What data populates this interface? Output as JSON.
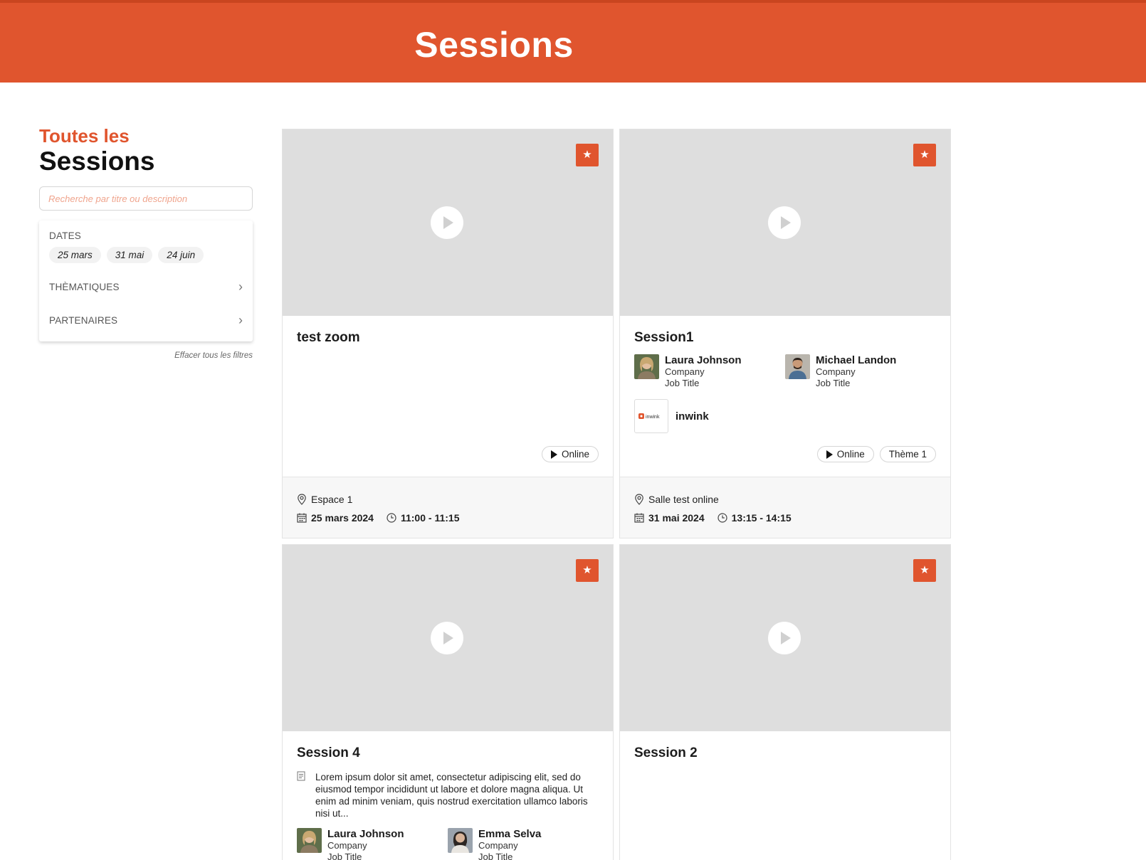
{
  "header": {
    "title": "Sessions"
  },
  "sidebar": {
    "kicker": "Toutes les",
    "title": "Sessions",
    "search_placeholder": "Recherche par titre ou description",
    "dates_label": "DATES",
    "date_chips": [
      "25 mars",
      "31 mai",
      "24 juin"
    ],
    "thematiques_label": "THÈMATIQUES",
    "partenaires_label": "PARTENAIRES",
    "clear_label": "Effacer tous les filtres"
  },
  "icons": {
    "favorite": "star-icon",
    "play": "play-icon",
    "location": "location-pin-icon",
    "calendar": "calendar-icon",
    "clock": "clock-icon",
    "description": "document-icon",
    "chevron": "chevron-right-icon"
  },
  "colors": {
    "brand": "#e0552e",
    "media_placeholder": "#dedede"
  },
  "cards": [
    {
      "title": "test zoom",
      "badges": [
        "Online"
      ],
      "location": "Espace 1",
      "date": "25 mars 2024",
      "time": "11:00 - 11:15"
    },
    {
      "title": "Session1",
      "speakers": [
        {
          "name": "Laura Johnson",
          "company": "Company",
          "job": "Job Title"
        },
        {
          "name": "Michael Landon",
          "company": "Company",
          "job": "Job Title"
        }
      ],
      "partner": {
        "name": "inwink",
        "logo_text": "inwink"
      },
      "badges": [
        "Online",
        "Thème 1"
      ],
      "location": "Salle test online",
      "date": "31 mai 2024",
      "time": "13:15 - 14:15"
    },
    {
      "title": "Session 4",
      "description": "Lorem ipsum dolor sit amet, consectetur adipiscing elit, sed do eiusmod tempor incididunt ut labore et dolore magna aliqua. Ut enim ad minim veniam, quis nostrud exercitation ullamco laboris nisi ut...",
      "speakers": [
        {
          "name": "Laura Johnson",
          "company": "Company",
          "job": "Job Title"
        },
        {
          "name": "Emma Selva",
          "company": "Company",
          "job": "Job Title"
        }
      ]
    },
    {
      "title": "Session 2"
    }
  ]
}
